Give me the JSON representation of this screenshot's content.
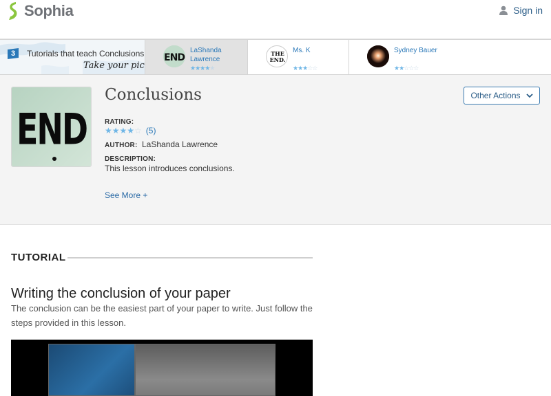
{
  "header": {
    "logo_text": "Sophia",
    "signin_label": "Sign in",
    "brand_color": "#8cc63f"
  },
  "strip": {
    "count": "3",
    "title": "Tutorials that teach Conclusions",
    "pick_text": "Take your pick:",
    "tutorials": [
      {
        "name": "LaShanda\nLawrence",
        "thumb": "END",
        "rating": 3.5,
        "active": true
      },
      {
        "name": "Ms. K",
        "thumb": "THE END.",
        "rating": 3,
        "active": false
      },
      {
        "name": "Sydney Bauer",
        "thumb": "sparkle",
        "rating": 2,
        "active": false
      }
    ]
  },
  "lesson": {
    "title": "Conclusions",
    "other_actions_label": "Other Actions",
    "rating_label": "RATING:",
    "rating_value": 4,
    "rating_count": "(5)",
    "author_label": "AUTHOR:",
    "author": "LaShanda Lawrence",
    "description_label": "DESCRIPTION:",
    "description": "This lesson introduces conclusions.",
    "see_more": "See More +",
    "cover_text": "END"
  },
  "tutorial": {
    "section_label": "TUTORIAL",
    "title": "Writing the conclusion of your paper",
    "description": "The conclusion can be the easiest part of your paper to write. Just follow the steps provided in this lesson."
  },
  "colors": {
    "link": "#2a78b8",
    "star_filled": "#6fb6e6",
    "star_empty": "#c9d9e6"
  }
}
